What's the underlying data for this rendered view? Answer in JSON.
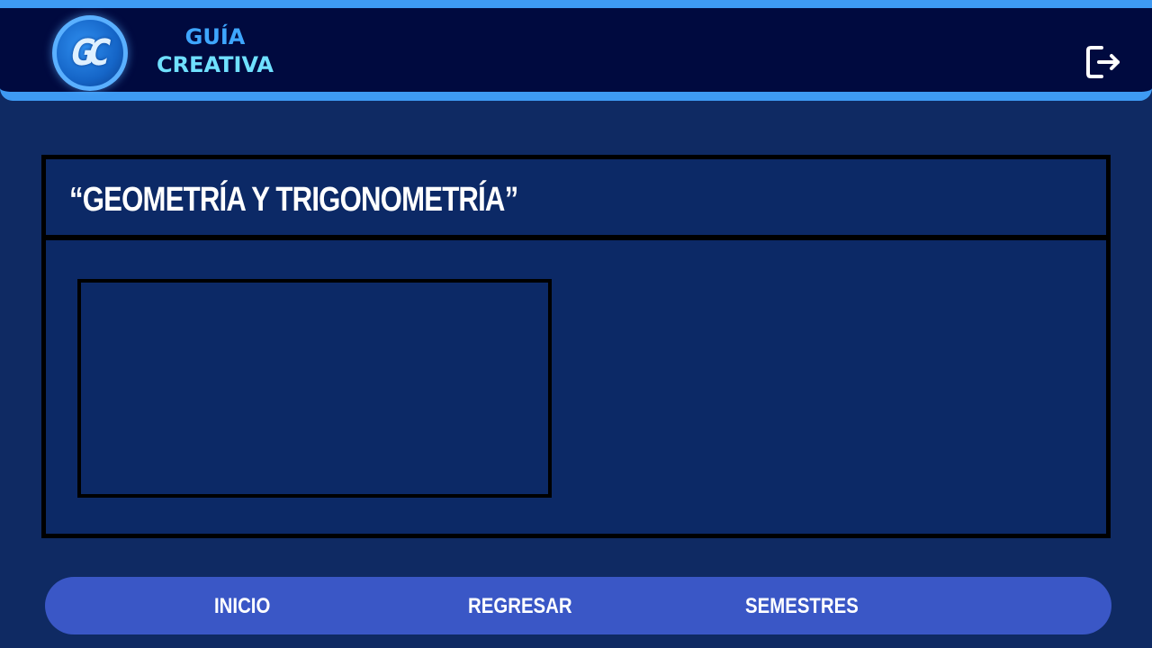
{
  "header": {
    "logo_letters": "GC",
    "brand_line1": "GUÍA",
    "brand_line2": "CREATIVA",
    "logout_icon": "logout-icon"
  },
  "panel": {
    "title": "“GEOMETRÍA Y TRIGONOMETRÍA”"
  },
  "nav": {
    "inicio": "INICIO",
    "regresar": "REGRESAR",
    "semestres": "SEMESTRES"
  },
  "colors": {
    "background": "#0f2a63",
    "header_bg": "#000a3f",
    "header_border": "#3e9af3",
    "brand_line1": "#3ea6ff",
    "brand_line2": "#6fe0ff",
    "nav_bg": "#3a57c6"
  }
}
